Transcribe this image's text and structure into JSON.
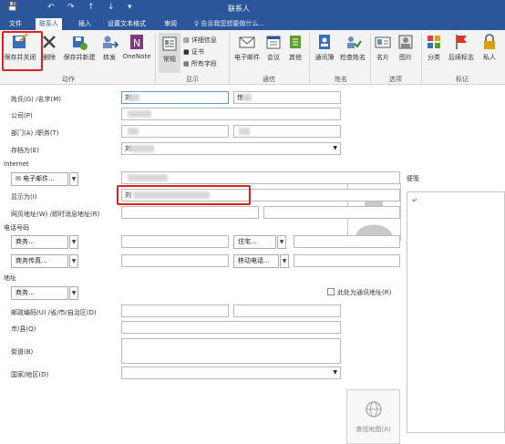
{
  "window": {
    "title": "联系人"
  },
  "tabs": [
    {
      "label": "文件"
    },
    {
      "label": "联系人"
    },
    {
      "label": "插入"
    },
    {
      "label": "设置文本格式"
    },
    {
      "label": "审阅"
    }
  ],
  "tell_me": "♀ 告诉我您想要做什么...",
  "ribbon": {
    "save_close": "保存并关闭",
    "delete": "删除",
    "save_new": "保存并新建",
    "forward": "转发",
    "onenote": "OneNote",
    "general": "常规",
    "details": "详细信息",
    "certificate": "证书",
    "all_fields": "所有字段",
    "email": "电子邮件",
    "meeting": "会议",
    "more": "其他",
    "address_book": "通讯簿",
    "check_names": "检查姓名",
    "business_card": "名片",
    "picture": "图片",
    "categorize": "分类",
    "followup": "后续标志",
    "private": "私人",
    "groups": {
      "actions": "动作",
      "show": "显示",
      "communicate": "通信",
      "names": "姓名",
      "options": "选项",
      "tags": "标记"
    }
  },
  "form": {
    "name_label": "姓氏(G) /名字(M)",
    "last_name": "刘",
    "first_name": "惊",
    "company_label": "公司(P)",
    "dept_label": "部门(A) /职务(T)",
    "file_as_label": "存档为(E)",
    "file_as_value": "刘",
    "internet_label": "Internet",
    "email_btn": "电子邮件...",
    "display_as_label": "显示为(I)",
    "display_as_value": "刘",
    "web_label": "网页地址(W) /即时消息地址(R)",
    "phones_label": "电话号码",
    "business_phone": "商务...",
    "home_phone": "住宅...",
    "business_fax": "商务传真...",
    "mobile_phone": "移动电话...",
    "address_section": "地址",
    "address_type": "商务...",
    "mailing_address_label": "此处为通讯地址(R)",
    "postal_label": "邮政编码(U) /省/市/自治区(D)",
    "city_label": "市/县(Q)",
    "street_label": "街道(B)",
    "country_label": "国家/地区(D)",
    "map_label": "查找地图(A)",
    "notes_label": "便笺",
    "notes_cursor": "↵"
  },
  "colors": {
    "accent": "#2b579a",
    "highlight": "#e02020"
  }
}
